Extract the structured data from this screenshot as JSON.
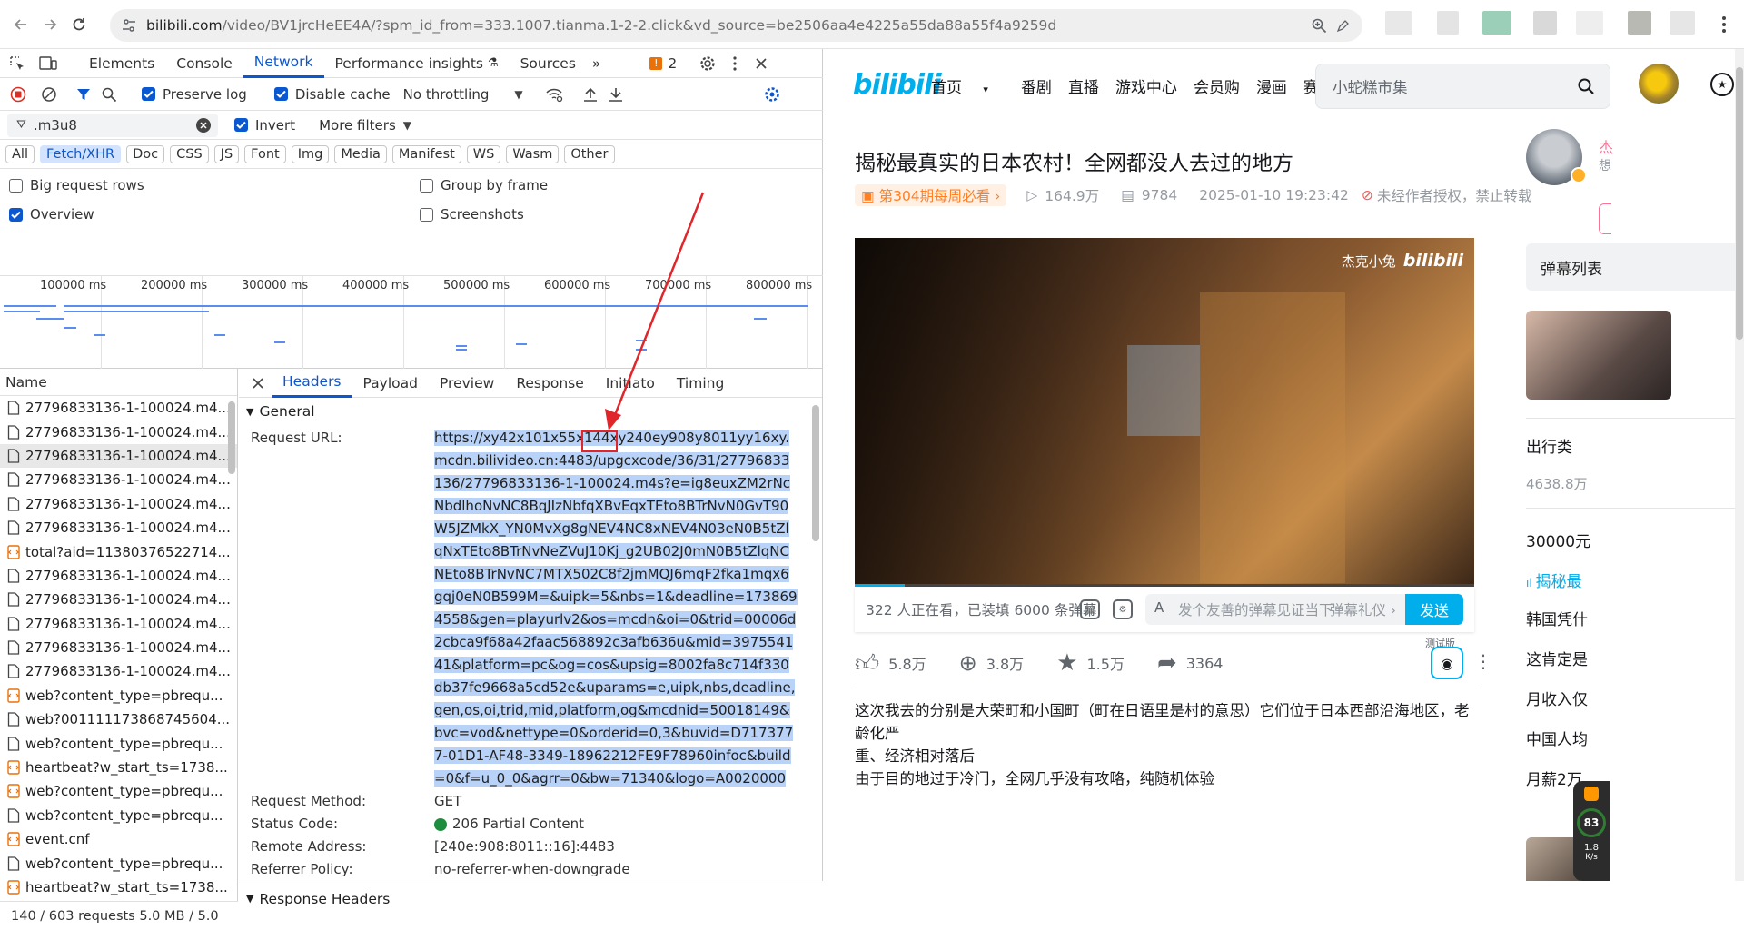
{
  "browser": {
    "url_host": "bilibili.com",
    "url_path": "/video/BV1jrcHeEE4A/?spm_id_from=333.1007.tianma.1-2-2.click&vd_source=be2506aa4e4225a55da88a55f4a9259d"
  },
  "devtools": {
    "tabs": [
      "Elements",
      "Console",
      "Network",
      "Performance insights",
      "Sources"
    ],
    "active_tab": "Network",
    "issues_count": "2",
    "toolbar": {
      "preserve_log": "Preserve log",
      "disable_cache": "Disable cache",
      "throttling": "No throttling"
    },
    "filter": {
      "value": ".m3u8",
      "invert": "Invert",
      "more_filters": "More filters"
    },
    "types": [
      "All",
      "Fetch/XHR",
      "Doc",
      "CSS",
      "JS",
      "Font",
      "Img",
      "Media",
      "Manifest",
      "WS",
      "Wasm",
      "Other"
    ],
    "options": {
      "big_rows": "Big request rows",
      "group_frame": "Group by frame",
      "overview": "Overview",
      "screenshots": "Screenshots"
    },
    "timeline_ticks": [
      "100000 ms",
      "200000 ms",
      "300000 ms",
      "400000 ms",
      "500000 ms",
      "600000 ms",
      "700000 ms",
      "800000 ms"
    ],
    "list_header": "Name",
    "requests": [
      {
        "name": "27796833136-1-100024.m4...",
        "type": "doc"
      },
      {
        "name": "27796833136-1-100024.m4...",
        "type": "doc"
      },
      {
        "name": "27796833136-1-100024.m4...",
        "type": "doc",
        "selected": true
      },
      {
        "name": "27796833136-1-100024.m4...",
        "type": "doc"
      },
      {
        "name": "27796833136-1-100024.m4...",
        "type": "doc"
      },
      {
        "name": "27796833136-1-100024.m4...",
        "type": "doc"
      },
      {
        "name": "total?aid=11380376522714...",
        "type": "xhr"
      },
      {
        "name": "27796833136-1-100024.m4...",
        "type": "doc"
      },
      {
        "name": "27796833136-1-100024.m4...",
        "type": "doc"
      },
      {
        "name": "27796833136-1-100024.m4...",
        "type": "doc"
      },
      {
        "name": "27796833136-1-100024.m4...",
        "type": "doc"
      },
      {
        "name": "27796833136-1-100024.m4...",
        "type": "doc"
      },
      {
        "name": "web?content_type=pbrequ...",
        "type": "xhr"
      },
      {
        "name": "web?001111173868745604...",
        "type": "doc"
      },
      {
        "name": "web?content_type=pbrequ...",
        "type": "doc"
      },
      {
        "name": "heartbeat?w_start_ts=1738...",
        "type": "xhr"
      },
      {
        "name": "web?content_type=pbrequ...",
        "type": "xhr"
      },
      {
        "name": "web?content_type=pbrequ...",
        "type": "doc"
      },
      {
        "name": "event.cnf",
        "type": "xhr"
      },
      {
        "name": "web?content_type=pbrequ...",
        "type": "doc"
      },
      {
        "name": "heartbeat?w_start_ts=1738...",
        "type": "xhr"
      }
    ],
    "status": "140 / 603 requests   5.0 MB / 5.0",
    "detail_tabs": [
      "Headers",
      "Payload",
      "Preview",
      "Response",
      "Initiato",
      "Timing"
    ],
    "general_title": "General",
    "request_url_label": "Request URL:",
    "request_url_pre": "https://xy42x101x55x144xy240ey908y8011yy16xy.mcdn.bilivideo.cn:4483/upgcxcode/36/31/27796833136/27796833136-1-100024",
    "request_url_ext": ".m4s",
    "request_url_post": "?e=ig8euxZM2rNcNbdlhoNvNC8BqJIzNbfqXBvEqxTEto8BTrNvN0GvT90W5JZMkX_YN0MvXg8gNEV4NC8xNEV4N03eN0B5tZlqNxTEto8BTrNvNeZVuJ10Kj_g2UB02J0mN0B5tZlqNCNEto8BTrNvNC7MTX502C8f2jmMQJ6mqF2fka1mqx6gqj0eN0B599M=&uipk=5&nbs=1&deadline=1738694558&gen=playurlv2&os=mcdn&oi=0&trid=00006d2cbca9f68a42faac568892c3afb636u&mid=397554141&platform=pc&og=cos&upsig=8002fa8c714f330db37fe9668a5cd52e&uparams=e,uipk,nbs,deadline,gen,os,oi,trid,mid,platform,og&mcdnid=50018149&bvc=vod&nettype=0&orderid=0,3&buvid=D7173777-01D1-AF48-3349-18962212FE9F78960infoc&build=0&f=u_0_0&agrr=0&bw=71340&logo=A0020000",
    "general_rows": [
      {
        "k": "Request Method:",
        "v": "GET"
      },
      {
        "k": "Status Code:",
        "v": "206 Partial Content"
      },
      {
        "k": "Remote Address:",
        "v": "[240e:908:8011::16]:4483"
      },
      {
        "k": "Referrer Policy:",
        "v": "no-referrer-when-downgrade"
      }
    ],
    "response_headers_title": "Response Headers"
  },
  "bili": {
    "logo": "bilibili",
    "nav": [
      "首页",
      "番剧",
      "直播",
      "游戏中心",
      "会员购",
      "漫画",
      "赛事"
    ],
    "search_placeholder": "小蛇糕市集",
    "video_title": "揭秘最真实的日本农村！全网都没人去过的地方",
    "weekly_badge": "第304期每周必看",
    "views": "164.9万",
    "danmu_count": "9784",
    "date": "2025-01-10 19:23:42",
    "copyright": "未经作者授权，禁止转载",
    "watermark": "杰克小兔",
    "watermark_logo": "bilibili",
    "viewers_text": "322 人正在看，已装填 6000 条弹幕",
    "danmu_placeholder": "发个友善的弹幕见证当下",
    "danmu_etiquette": "弹幕礼仪",
    "send": "发送",
    "test_label": "测试版",
    "likes": "5.8万",
    "coins": "3.8万",
    "favorites": "1.5万",
    "shares": "3364",
    "desc_lines": [
      "这次我去的分别是大荣町和小国町（町在日语里是村的意思）它们位于日本西部沿海地区，老龄化严",
      "重、经济相对落后",
      "由于目的地过于冷门，全网几乎没有攻略，纯随机体验"
    ],
    "side": {
      "author_initial": "杰",
      "author_sub": "想",
      "danmu_list": "弹幕列表",
      "rec1_title": "出行类",
      "rec1_views": "4638.8万",
      "rec2_title": "30000元",
      "rec3_title": "揭秘最",
      "rec4": "韩国凭什",
      "rec5": "这肯定是",
      "rec6": "月收入仅",
      "rec7": "中国人均",
      "rec8": "月薪2万",
      "speed_pct": "83",
      "speed_rate": "1.8",
      "speed_unit": "K/s"
    }
  }
}
